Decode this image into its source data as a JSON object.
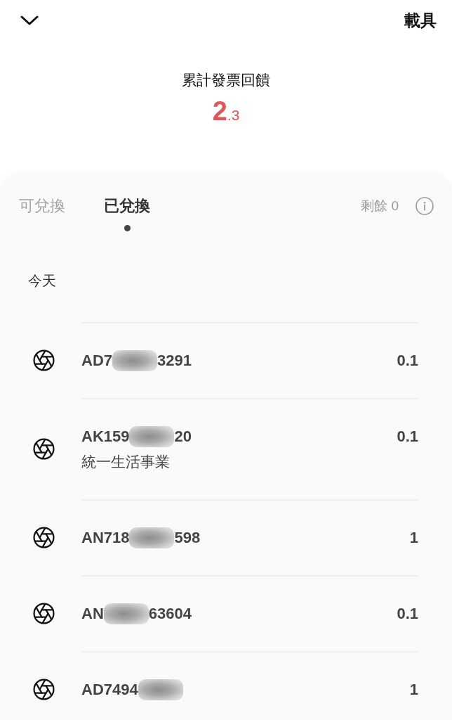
{
  "header": {
    "action": "載具"
  },
  "summary": {
    "label": "累計發票回饋",
    "whole": "2",
    "fraction": ".3"
  },
  "tabs": [
    {
      "label": "可兌換",
      "selected": false
    },
    {
      "label": "已兌換",
      "selected": true
    }
  ],
  "remaining": "剩餘 0",
  "groups": [
    {
      "heading": "今天",
      "items": [
        {
          "number_start": "AD7",
          "number_end": "3291",
          "amount": "0.1"
        },
        {
          "number_start": "AK159",
          "number_end": "20",
          "store": "統一生活事業",
          "amount": "0.1"
        },
        {
          "number_start": "AN718",
          "number_end": "598",
          "amount": "1"
        },
        {
          "number_start": "AN",
          "number_end": "63604",
          "amount": "0.1"
        },
        {
          "number_start": "AD7494",
          "amount": "1"
        }
      ]
    }
  ]
}
